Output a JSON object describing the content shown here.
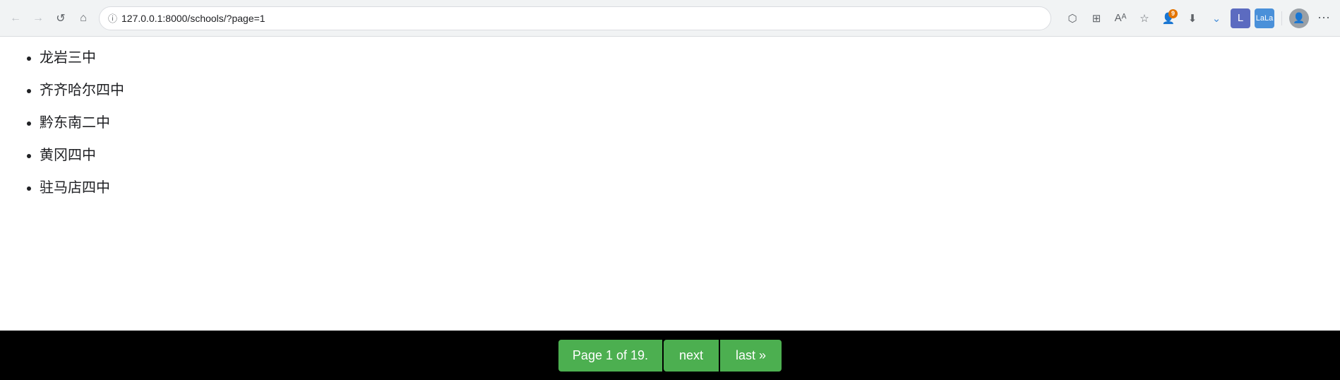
{
  "browser": {
    "url": "127.0.0.1:8000/schools/?page=1",
    "back_label": "←",
    "forward_label": "→",
    "reload_label": "↺",
    "home_label": "⌂",
    "security_icon": "ⓘ",
    "badge_count": "9",
    "more_label": "⋯"
  },
  "schools": {
    "items": [
      {
        "name": "龙岩三中"
      },
      {
        "name": "齐齐哈尔四中"
      },
      {
        "name": "黔东南二中"
      },
      {
        "name": "黄冈四中"
      },
      {
        "name": "驻马店四中"
      }
    ]
  },
  "pagination": {
    "page_info": "Page 1 of 19.",
    "next_label": "next",
    "last_label": "last »",
    "current_page": 1,
    "total_pages": 19
  }
}
